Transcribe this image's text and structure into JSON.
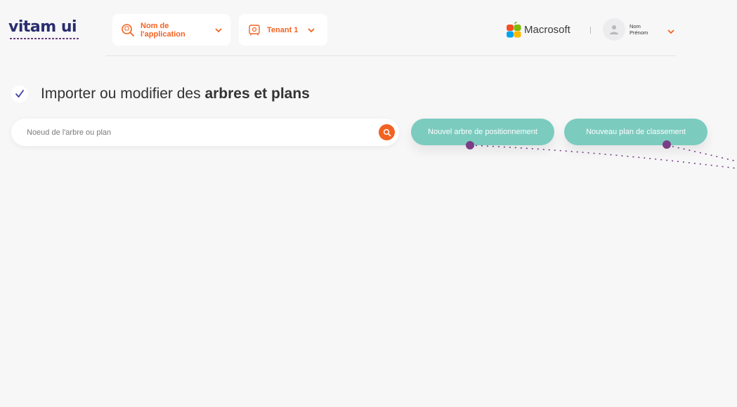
{
  "header": {
    "logo_text": "vitam ui",
    "app_selector_label": "Nom de l'application",
    "tenant_selector_label": "Tenant 1",
    "org_name": "Macrosoft",
    "user_first": "Nom",
    "user_last": "Prénom"
  },
  "page": {
    "title_regular": "Importer ou modifier des ",
    "title_bold": "arbres et plans"
  },
  "search": {
    "placeholder": "Noeud de l'arbre ou plan"
  },
  "actions": {
    "new_tree_label": "Nouvel arbre de positionnement",
    "new_plan_label": "Nouveau plan de classement"
  },
  "colors": {
    "accent_orange": "#f26322",
    "teal": "#7ccbbf",
    "brand_navy": "#2a2e6e",
    "connector_purple": "#7a3e86"
  },
  "icons": {
    "app_selector": "search-app-icon",
    "tenant_selector": "safe-icon",
    "chevron": "chevron-down-icon",
    "search": "search-icon",
    "check": "check-icon",
    "user": "user-icon",
    "org": "macrosoft-logo-icon"
  }
}
